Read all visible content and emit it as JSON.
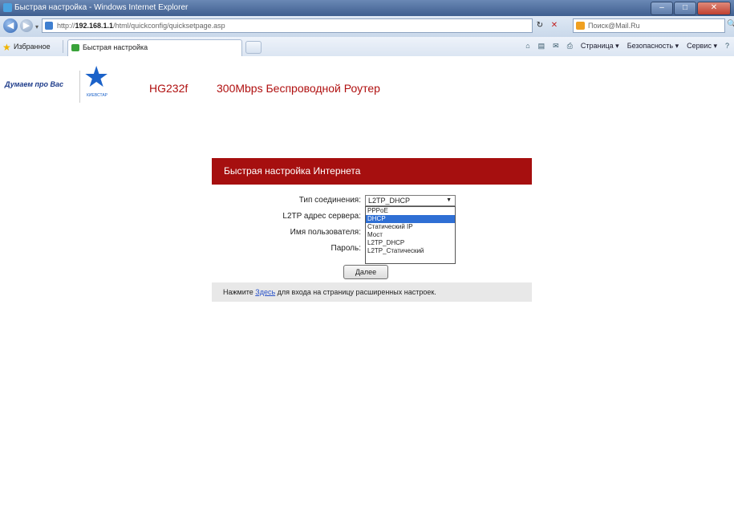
{
  "window": {
    "title": "Быстрая настройка - Windows Internet Explorer",
    "controls": {
      "minimize": "–",
      "maximize": "□",
      "close": "✕"
    }
  },
  "addressbar": {
    "url_prefix": "http://",
    "url_host": "192.168.1.1",
    "url_path": "/html/quickconfig/quicksetpage.asp",
    "refresh_glyph": "↻",
    "stop_glyph": "✕",
    "search_placeholder": "Поиск@Mail.Ru",
    "search_go": "🔍"
  },
  "favorites": {
    "label": "Избранное",
    "tab_title": "Быстрая настройка"
  },
  "commandbar": {
    "home_glyph": "⌂",
    "feeds_glyph": "▤",
    "mail_glyph": "✉",
    "print_glyph": "⎙",
    "page": "Страница ▾",
    "safety": "Безопасность ▾",
    "tools": "Сервис ▾",
    "help_glyph": "?"
  },
  "router": {
    "slogan": "Думаем про Вас",
    "logo_glyph": "★",
    "logo_text": "КИЕВСТАР",
    "model": "HG232f",
    "subtitle": "300Mbps Беспроводной Роутер"
  },
  "quick_setup": {
    "heading": "Быстрая настройка Интернета",
    "connection_type_label": "Тип соединения:",
    "server_label": "L2TP адрес сервера:",
    "username_label": "Имя пользователя:",
    "password_label": "Пароль:",
    "selected_type": "L2TP_DHCP",
    "dropdown_arrow": "▼",
    "options": [
      "PPPoE",
      "DHCP",
      "Статический IP",
      "Мост",
      "L2TP_DHCP",
      "L2TP_Статический"
    ],
    "highlighted_option": "DHCP",
    "next_button": "Далее",
    "footer_before": "Нажмите ",
    "footer_link": "Здесь",
    "footer_after": " для входа на страницу расширенных настроек."
  },
  "colors": {
    "brand_red": "#a60f0f",
    "title_red": "#b01010",
    "logo_blue": "#1b62c9",
    "selection_blue": "#2f6fd4",
    "link_blue": "#2a53c9"
  }
}
